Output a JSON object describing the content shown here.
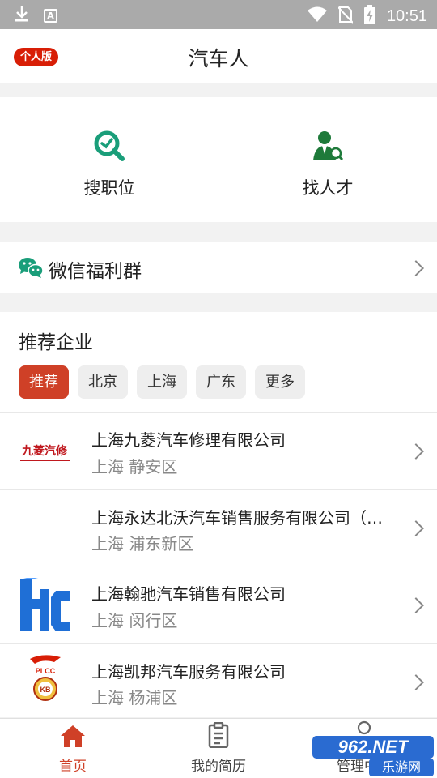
{
  "status_bar": {
    "time": "10:51",
    "left_icons": [
      "download-icon",
      "a-icon"
    ],
    "right_icons": [
      "wifi-icon",
      "no-sim-icon",
      "battery-charging-icon"
    ]
  },
  "header": {
    "badge": "个人版",
    "title": "汽车人"
  },
  "quick_actions": [
    {
      "label": "搜职位",
      "icon": "job-search-icon"
    },
    {
      "label": "找人才",
      "icon": "talent-search-icon"
    }
  ],
  "wechat_group": {
    "label": "微信福利群",
    "icon": "wechat-icon"
  },
  "recommended": {
    "title": "推荐企业",
    "chips": [
      "推荐",
      "北京",
      "上海",
      "广东",
      "更多"
    ],
    "active_chip": "推荐",
    "companies": [
      {
        "name": "上海九菱汽车修理有限公司",
        "location": "上海 静安区",
        "logo_text": "九菱汽修"
      },
      {
        "name": "上海永达北沃汽车销售服务有限公司（…",
        "location": "上海 浦东新区",
        "logo_text": ""
      },
      {
        "name": "上海翰驰汽车销售有限公司",
        "location": "上海 闵行区",
        "logo_text": ""
      },
      {
        "name": "上海凯邦汽车服务有限公司",
        "location": "上海 杨浦区",
        "logo_text": "PLCC"
      }
    ]
  },
  "tab_bar": {
    "tabs": [
      {
        "label": "首页",
        "icon": "home-icon",
        "active": true
      },
      {
        "label": "我的简历",
        "icon": "resume-icon",
        "active": false
      },
      {
        "label": "管理中心",
        "icon": "profile-icon",
        "active": false
      }
    ]
  },
  "watermark": {
    "brand": "962.NET",
    "sub": "乐游网"
  },
  "colors": {
    "accent": "#cf4027",
    "icon_green": "#1a9e7a",
    "badge_red": "#d81e06"
  }
}
